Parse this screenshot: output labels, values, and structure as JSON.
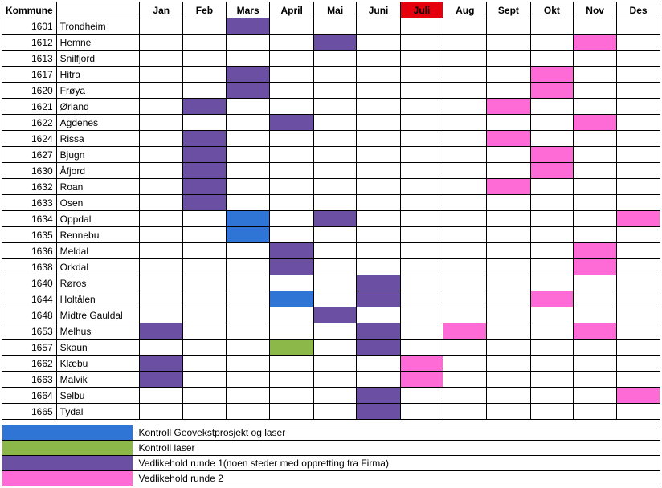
{
  "headers": {
    "kommune": "Kommune",
    "months": [
      "Jan",
      "Feb",
      "Mars",
      "April",
      "Mai",
      "Juni",
      "Juli",
      "Aug",
      "Sept",
      "Okt",
      "Nov",
      "Des"
    ]
  },
  "highlight_header_index": 6,
  "colors": {
    "purple": "#6a4fa3",
    "pink": "#ff6bd6",
    "blue": "#2e75d6",
    "green": "#8cb84a"
  },
  "rows": [
    {
      "code": "1601",
      "name": "Trondheim",
      "cells": {
        "2": "purple"
      }
    },
    {
      "code": "1612",
      "name": "Hemne",
      "cells": {
        "4": "purple",
        "10": "pink"
      }
    },
    {
      "code": "1613",
      "name": "Snilfjord",
      "cells": {}
    },
    {
      "code": "1617",
      "name": "Hitra",
      "cells": {
        "2": "purple",
        "9": "pink"
      }
    },
    {
      "code": "1620",
      "name": "Frøya",
      "cells": {
        "2": "purple",
        "9": "pink"
      }
    },
    {
      "code": "1621",
      "name": "Ørland",
      "cells": {
        "1": "purple",
        "8": "pink"
      }
    },
    {
      "code": "1622",
      "name": "Agdenes",
      "cells": {
        "3": "purple",
        "10": "pink"
      }
    },
    {
      "code": "1624",
      "name": "Rissa",
      "cells": {
        "1": "purple",
        "8": "pink"
      }
    },
    {
      "code": "1627",
      "name": "Bjugn",
      "cells": {
        "1": "purple",
        "9": "pink"
      }
    },
    {
      "code": "1630",
      "name": "Åfjord",
      "cells": {
        "1": "purple",
        "9": "pink"
      }
    },
    {
      "code": "1632",
      "name": "Roan",
      "cells": {
        "1": "purple",
        "8": "pink"
      }
    },
    {
      "code": "1633",
      "name": "Osen",
      "cells": {
        "1": "purple"
      }
    },
    {
      "code": "1634",
      "name": "Oppdal",
      "cells": {
        "2": "blue",
        "4": "purple",
        "11": "pink"
      }
    },
    {
      "code": "1635",
      "name": "Rennebu",
      "cells": {
        "2": "blue"
      }
    },
    {
      "code": "1636",
      "name": "Meldal",
      "cells": {
        "3": "purple",
        "10": "pink"
      }
    },
    {
      "code": "1638",
      "name": "Orkdal",
      "cells": {
        "3": "purple",
        "10": "pink"
      }
    },
    {
      "code": "1640",
      "name": "Røros",
      "cells": {
        "5": "purple"
      }
    },
    {
      "code": "1644",
      "name": "Holtålen",
      "cells": {
        "3": "blue",
        "5": "purple",
        "9": "pink"
      }
    },
    {
      "code": "1648",
      "name": "Midtre Gauldal",
      "cells": {
        "4": "purple"
      }
    },
    {
      "code": "1653",
      "name": "Melhus",
      "cells": {
        "0": "purple",
        "5": "purple",
        "7": "pink",
        "10": "pink"
      }
    },
    {
      "code": "1657",
      "name": "Skaun",
      "cells": {
        "3": "green",
        "5": "purple"
      }
    },
    {
      "code": "1662",
      "name": "Klæbu",
      "cells": {
        "0": "purple",
        "6": "pink"
      }
    },
    {
      "code": "1663",
      "name": "Malvik",
      "cells": {
        "0": "purple",
        "6": "pink"
      }
    },
    {
      "code": "1664",
      "name": "Selbu",
      "cells": {
        "5": "purple",
        "11": "pink"
      }
    },
    {
      "code": "1665",
      "name": "Tydal",
      "cells": {
        "5": "purple"
      }
    }
  ],
  "legend": [
    {
      "color": "blue",
      "label": "Kontroll Geovekstprosjekt og laser"
    },
    {
      "color": "green",
      "label": "Kontroll laser"
    },
    {
      "color": "purple",
      "label": "Vedlikehold runde 1(noen steder med oppretting fra Firma)"
    },
    {
      "color": "pink",
      "label": "Vedlikehold runde 2"
    }
  ]
}
